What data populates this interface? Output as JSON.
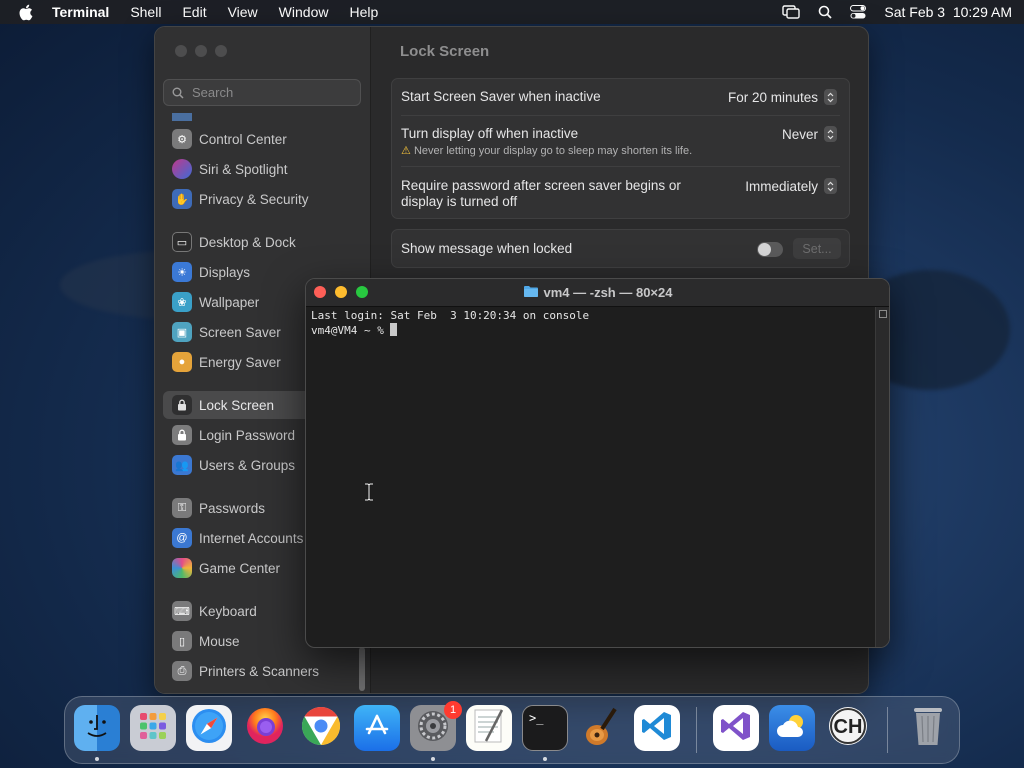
{
  "menubar": {
    "app_name": "Terminal",
    "items": [
      "Shell",
      "Edit",
      "View",
      "Window",
      "Help"
    ],
    "clock": "Sat Feb 3  10:29 AM"
  },
  "settings": {
    "search_placeholder": "Search",
    "pane_title": "Lock Screen",
    "sidebar": [
      {
        "label": "Control Center",
        "icon": "control-center-icon"
      },
      {
        "label": "Siri & Spotlight",
        "icon": "siri-icon"
      },
      {
        "label": "Privacy & Security",
        "icon": "hand-icon"
      },
      {
        "label": "Desktop & Dock",
        "icon": "desktop-icon"
      },
      {
        "label": "Displays",
        "icon": "sun-icon"
      },
      {
        "label": "Wallpaper",
        "icon": "wallpaper-icon"
      },
      {
        "label": "Screen Saver",
        "icon": "screen-saver-icon"
      },
      {
        "label": "Energy Saver",
        "icon": "bulb-icon"
      },
      {
        "label": "Lock Screen",
        "icon": "lock-icon",
        "selected": true
      },
      {
        "label": "Login Password",
        "icon": "lock-icon"
      },
      {
        "label": "Users & Groups",
        "icon": "users-icon"
      },
      {
        "label": "Passwords",
        "icon": "key-icon"
      },
      {
        "label": "Internet Accounts",
        "icon": "at-icon"
      },
      {
        "label": "Game Center",
        "icon": "game-center-icon"
      },
      {
        "label": "Keyboard",
        "icon": "keyboard-icon"
      },
      {
        "label": "Mouse",
        "icon": "mouse-icon"
      },
      {
        "label": "Printers & Scanners",
        "icon": "printer-icon"
      }
    ],
    "rows": {
      "screen_saver_label": "Start Screen Saver when inactive",
      "screen_saver_value": "For 20 minutes",
      "display_off_label": "Turn display off when inactive",
      "display_off_warning": "Never letting your display go to sleep may shorten its life.",
      "display_off_value": "Never",
      "require_password_label_1": "Require password after screen saver begins or",
      "require_password_label_2": "display is turned off",
      "require_password_value": "Immediately",
      "show_message_label": "Show message when locked",
      "set_button": "Set..."
    }
  },
  "terminal": {
    "title": "vm4 — -zsh — 80×24",
    "line1": "Last login: Sat Feb  3 10:20:34 on console",
    "prompt": "vm4@VM4 ~ % "
  },
  "dock": {
    "apps": [
      "Finder",
      "Launchpad",
      "Safari",
      "Firefox",
      "Chrome",
      "App Store",
      "System Settings",
      "TextEdit",
      "Terminal",
      "GarageBand",
      "Visual Studio Code",
      "Visual Studio",
      "Weather",
      "CH"
    ],
    "settings_badge": "1"
  },
  "colors": {
    "accent_red": "#fe5f57",
    "accent_yellow": "#febc2e",
    "accent_green": "#28c840",
    "badge_red": "#ff3b30"
  }
}
